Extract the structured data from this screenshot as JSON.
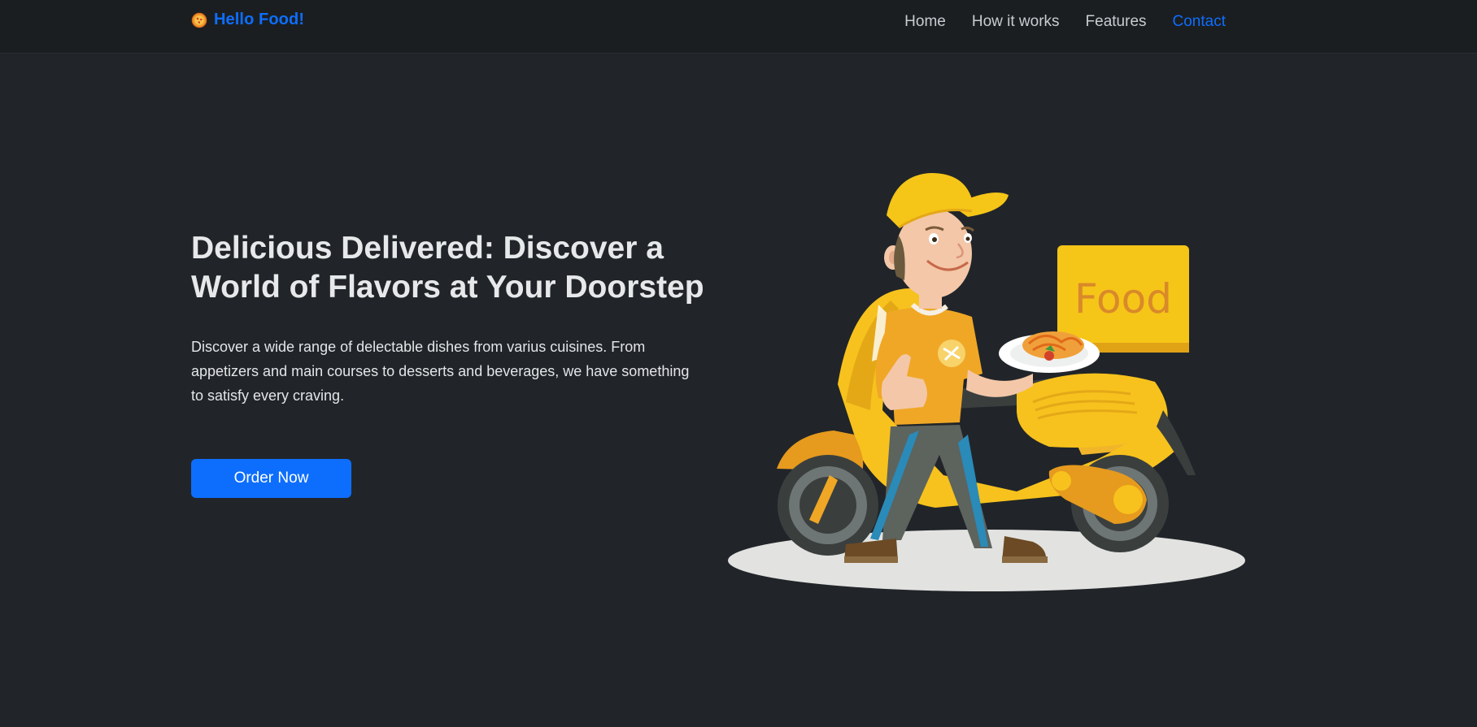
{
  "navbar": {
    "brand": "Hello Food!",
    "brand_icon": "pizza-icon",
    "links": [
      {
        "label": "Home",
        "active": false
      },
      {
        "label": "How it works",
        "active": false
      },
      {
        "label": "Features",
        "active": false
      },
      {
        "label": "Contact",
        "active": true
      }
    ]
  },
  "hero": {
    "title": "Delicious Delivered: Discover a World of Flavors at Your Doorstep",
    "description": "Discover a wide range of delectable dishes from varius cuisines. From appetizers and main courses to desserts and beverages, we have something to satisfy every craving.",
    "cta_label": "Order Now",
    "illustration": {
      "box_label": "Food"
    }
  },
  "colors": {
    "background": "#212529",
    "navbar": "#1b1e21",
    "accent": "#0d6efd",
    "scooter_yellow": "#f5c518"
  }
}
